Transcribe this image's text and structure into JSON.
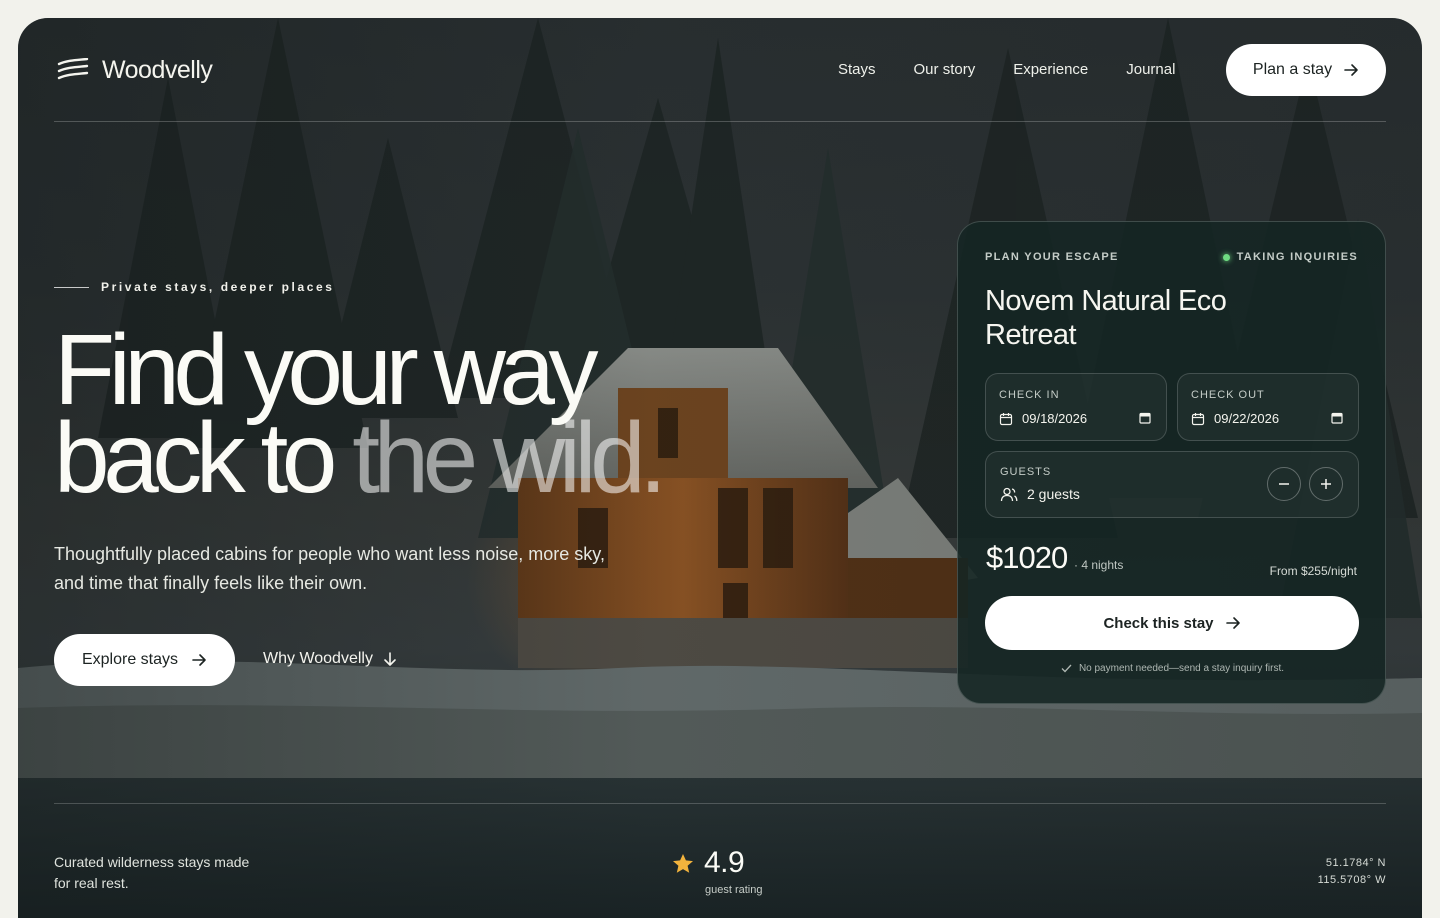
{
  "brand": {
    "name": "Woodvelly",
    "logo_icon": "layered-lines-logo"
  },
  "nav": {
    "items": [
      "Stays",
      "Our story",
      "Experience",
      "Journal"
    ],
    "cta_label": "Plan a stay"
  },
  "hero": {
    "eyebrow": "Private stays, deeper places",
    "headline_line1": "Find your way",
    "headline_line2_bright": "back to ",
    "headline_line2_dim": "the wild.",
    "lede": "Thoughtfully placed cabins for people who want less noise, more sky, and time that finally feels like their own.",
    "primary_cta": "Explore stays",
    "secondary_cta": "Why Woodvelly"
  },
  "booking": {
    "kicker": "PLAN YOUR ESCAPE",
    "status": "TAKING INQUIRIES",
    "status_color": "#6fdc82",
    "property": "Novem Natural Eco Retreat",
    "check_in_label": "CHECK IN",
    "check_in_value": "09/18/2026",
    "check_out_label": "CHECK OUT",
    "check_out_value": "09/22/2026",
    "guests_label": "GUESTS",
    "guests_value": "2 guests",
    "price": "$1020",
    "nights": "· 4 nights",
    "from_price": "From $255/night",
    "cta": "Check this stay",
    "note": "No payment needed—send a stay inquiry first."
  },
  "footer_strip": {
    "tagline": "Curated wilderness stays made for real rest.",
    "rating_value": "4.9",
    "rating_label": "guest rating",
    "star_color": "#f2b33d",
    "lat": "51.1784° N",
    "lon": "115.5708° W"
  },
  "colors": {
    "card_bg": "#152623",
    "page_bg": "#f2f2ec",
    "text": "#fbfbf6"
  }
}
